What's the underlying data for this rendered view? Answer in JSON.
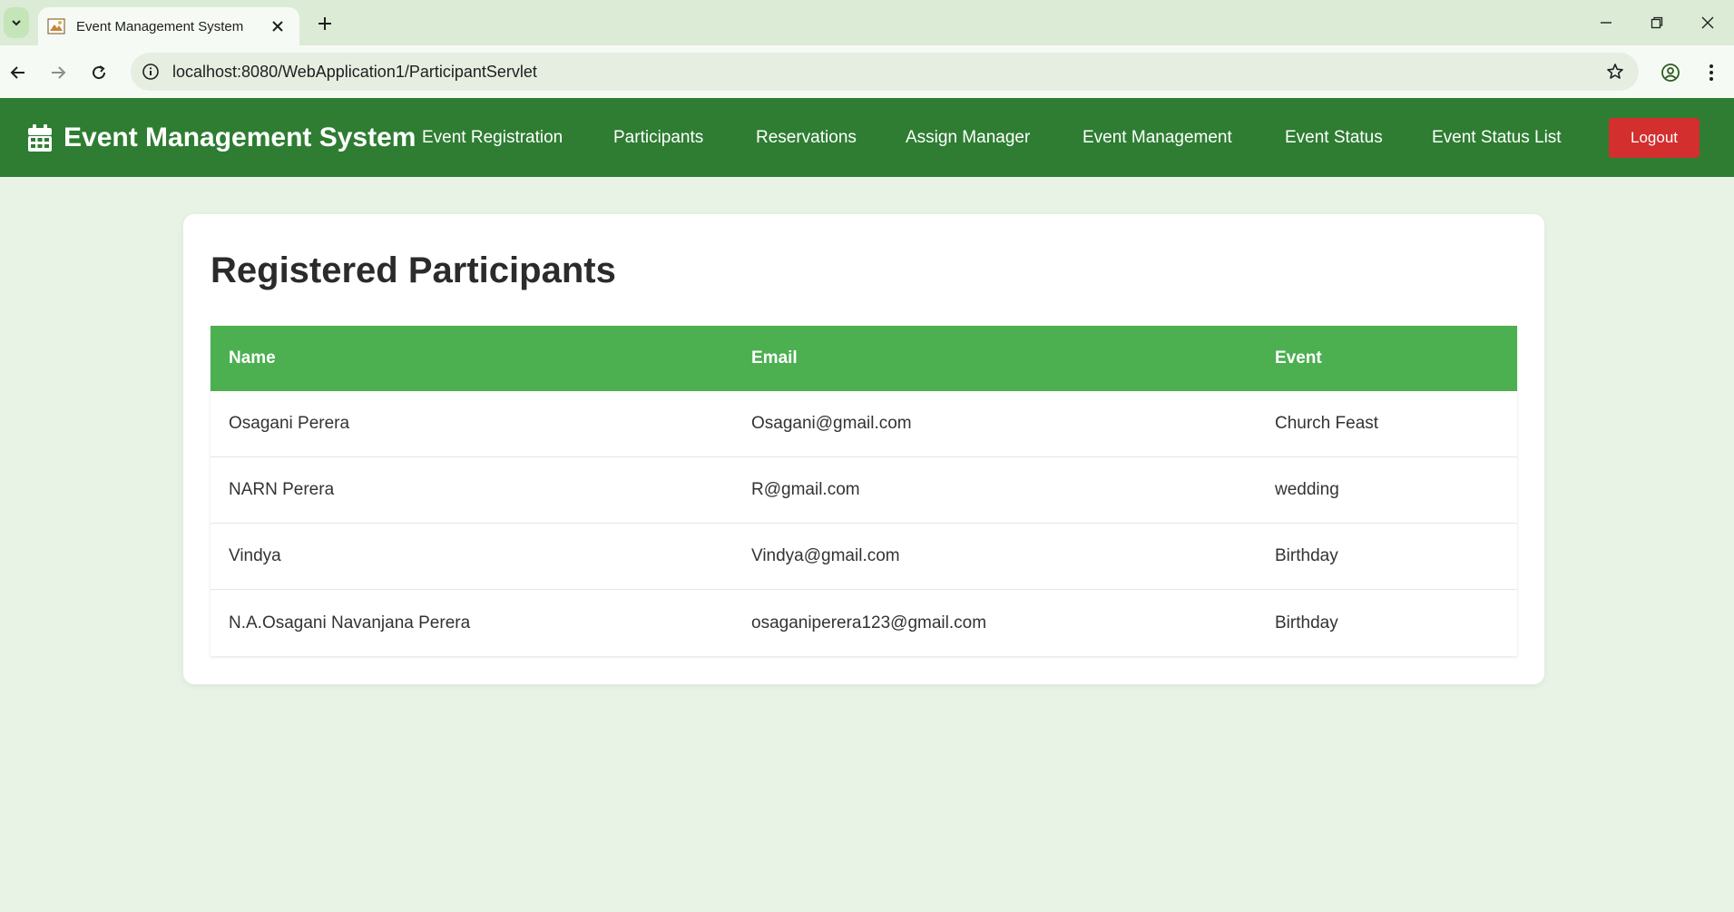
{
  "browser": {
    "tab_title": "Event Management System",
    "url": "localhost:8080/WebApplication1/ParticipantServlet"
  },
  "app": {
    "brand": "Event Management System",
    "nav": [
      "Event Registration",
      "Participants",
      "Reservations",
      "Assign Manager",
      "Event Management",
      "Event Status",
      "Event Status List"
    ],
    "logout_label": "Logout"
  },
  "main": {
    "title": "Registered Participants",
    "columns": [
      "Name",
      "Email",
      "Event"
    ],
    "rows": [
      [
        "Osagani Perera",
        "Osagani@gmail.com",
        "Church Feast"
      ],
      [
        "NARN Perera",
        "R@gmail.com",
        "wedding"
      ],
      [
        "Vindya",
        "Vindya@gmail.com",
        "Birthday"
      ],
      [
        "N.A.Osagani Navanjana Perera",
        "osaganiperera123@gmail.com",
        "Birthday"
      ]
    ]
  },
  "colors": {
    "nav_bg": "#2e7d32",
    "table_header_bg": "#4caf50",
    "logout_bg": "#d32f2f",
    "page_bg": "#e8f3e6"
  },
  "icons": {
    "brand": "calendar-icon",
    "tab_menu": "chevron-down-icon",
    "tab_close": "close-icon",
    "new_tab": "plus-icon",
    "back": "arrow-left-icon",
    "forward": "arrow-right-icon",
    "reload": "reload-icon",
    "site_info": "info-icon",
    "bookmark": "star-icon",
    "profile": "profile-icon",
    "menu": "kebab-menu-icon"
  }
}
